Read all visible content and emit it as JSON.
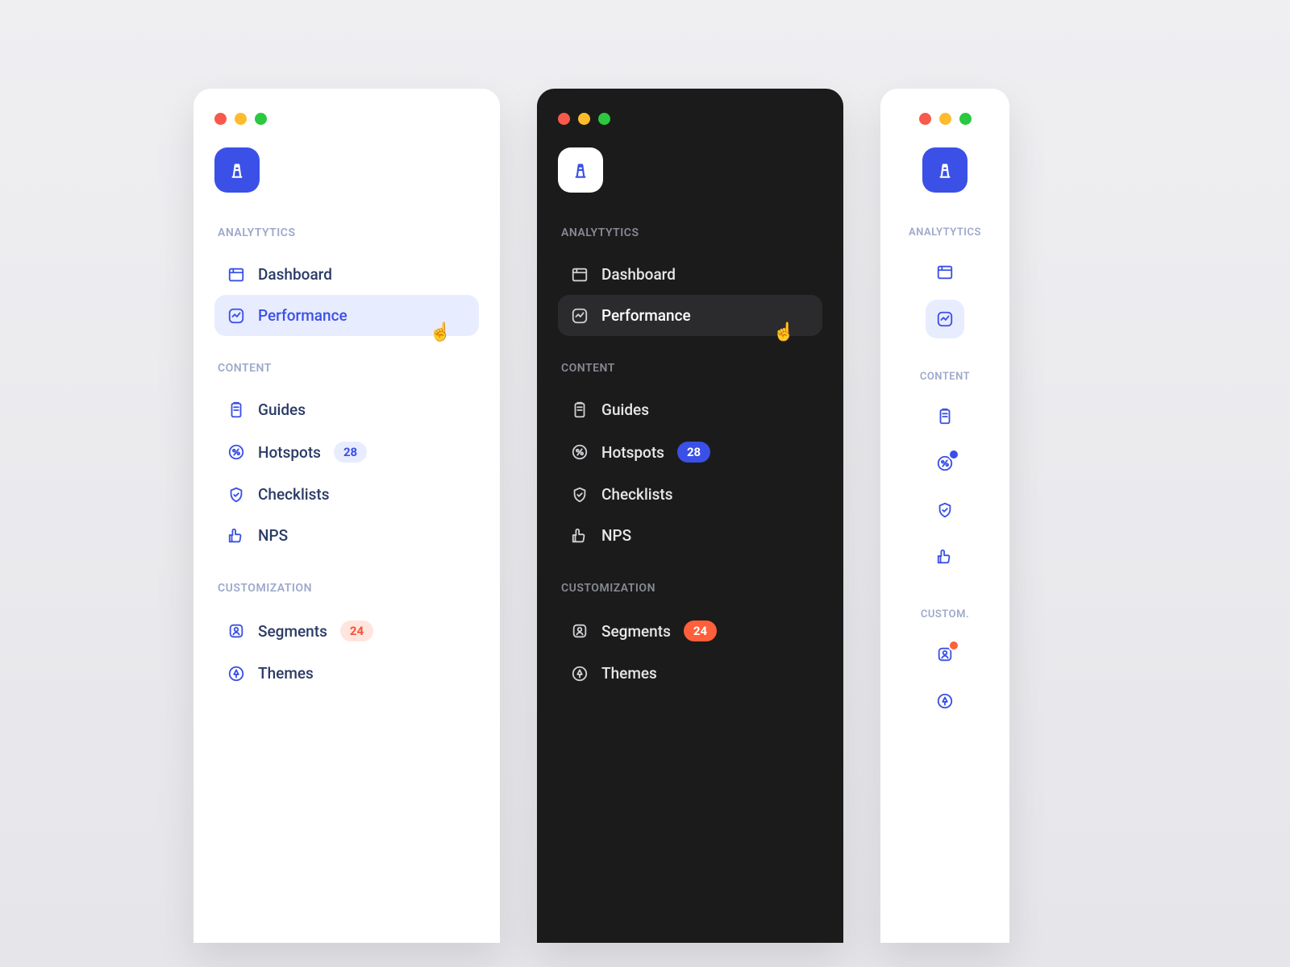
{
  "sections": {
    "analytics": "ANALYTYTICS",
    "content": "CONTENT",
    "customization": "CUSTOMIZATION",
    "customization_short": "CUSTOM."
  },
  "nav": {
    "dashboard": "Dashboard",
    "performance": "Performance",
    "guides": "Guides",
    "hotspots": "Hotspots",
    "checklists": "Checklists",
    "nps": "NPS",
    "segments": "Segments",
    "themes": "Themes"
  },
  "badges": {
    "hotspots": "28",
    "segments": "24"
  },
  "colors": {
    "primary": "#3B50E6",
    "accent_red": "#FF5F3B",
    "dark_bg": "#1B1B1B"
  }
}
